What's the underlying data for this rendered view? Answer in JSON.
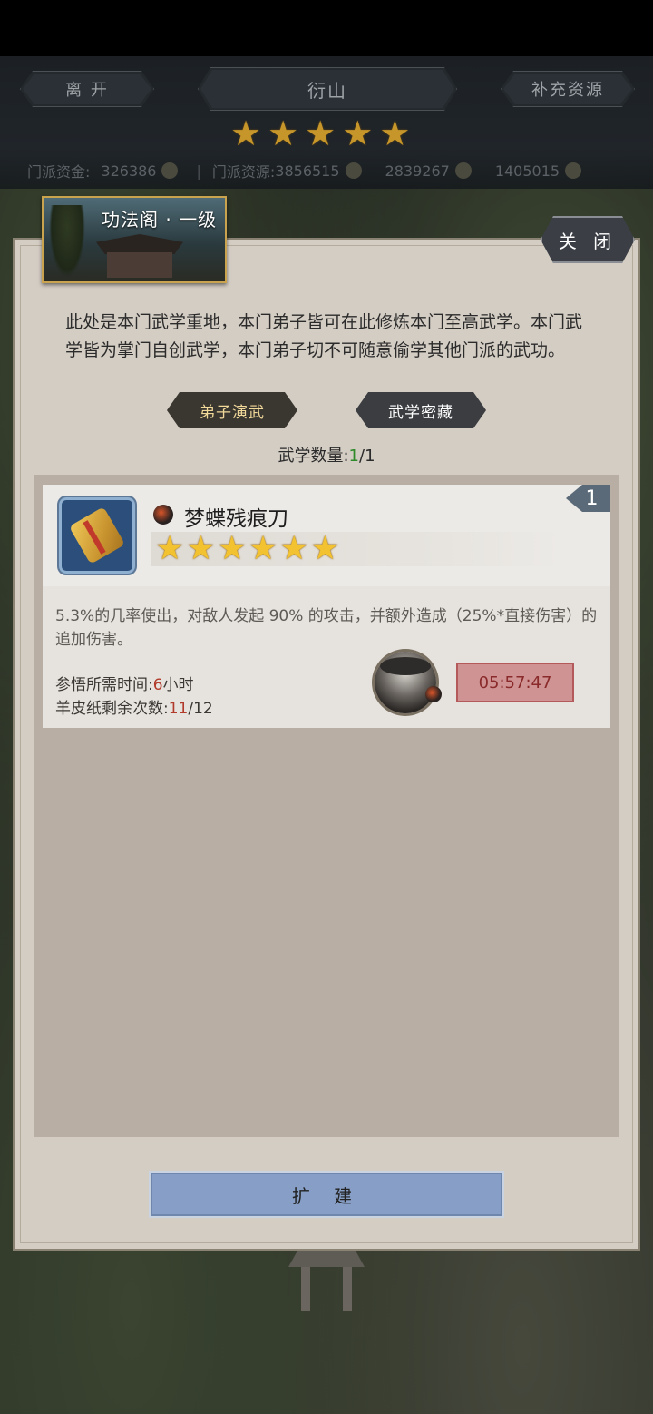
{
  "hud": {
    "leave_label": "离 开",
    "sect_name": "衍山",
    "replenish_label": "补充资源",
    "sect_stars": 5,
    "resources": {
      "funds_label": "门派资金:",
      "funds_value": "326386",
      "materials_label": "门派资源:",
      "materials_value": "3856515",
      "res3_value": "2839267",
      "res4_value": "1405015"
    }
  },
  "panel": {
    "title": "功法阁 · 一级",
    "close_label": "关 闭",
    "description": "此处是本门武学重地，本门弟子皆可在此修炼本门至高武学。本门武学皆为掌门自创武学，本门弟子切不可随意偷学其他门派的武功。",
    "tabs": [
      "弟子演武",
      "武学密藏"
    ],
    "count_label": "武学数量:",
    "count_current": "1",
    "count_total": "/1"
  },
  "skill": {
    "rank": "1",
    "name": "梦蝶残痕刀",
    "stars": 6,
    "effect": "5.3%的几率使出，对敌人发起 90% 的攻击，并额外造成（25%*直接伤害）的追加伤害。",
    "time_label": "参悟所需时间:",
    "time_value": "6",
    "time_unit": "小时",
    "parchment_label": "羊皮纸剩余次数:",
    "parchment_value": "11",
    "parchment_total": "/12",
    "timer": "05:57:47"
  },
  "footer": {
    "expand_label": "扩 建"
  }
}
